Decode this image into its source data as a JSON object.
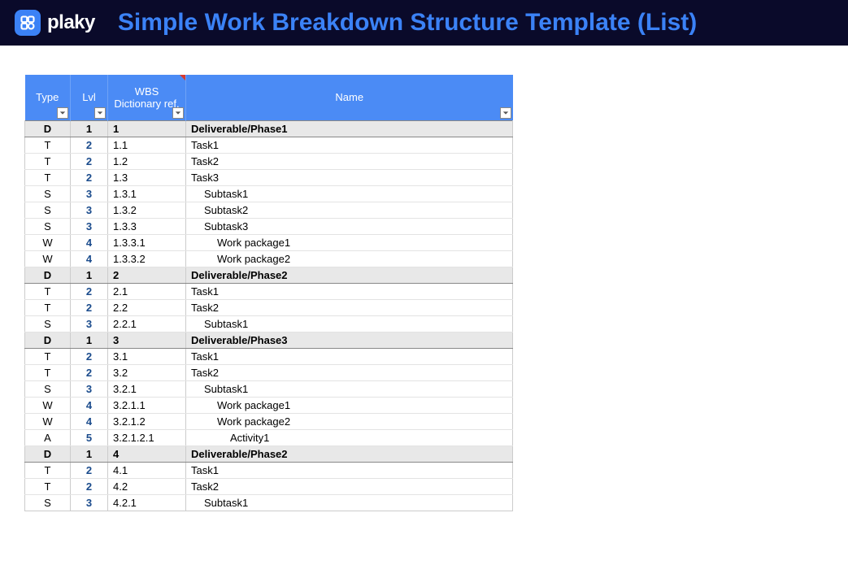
{
  "banner": {
    "brand": "plaky",
    "title": "Simple Work Breakdown Structure Template (List)"
  },
  "columns": {
    "type": "Type",
    "lvl": "Lvl",
    "wbs": "WBS Dictionary ref.",
    "name": "Name"
  },
  "rows": [
    {
      "type": "D",
      "lvl": "1",
      "wbs": "1",
      "name": "Deliverable/Phase1",
      "hl": true,
      "indent": 1
    },
    {
      "type": "T",
      "lvl": "2",
      "wbs": "1.1",
      "name": "Task1",
      "indent": 1
    },
    {
      "type": "T",
      "lvl": "2",
      "wbs": "1.2",
      "name": "Task2",
      "indent": 1
    },
    {
      "type": "T",
      "lvl": "2",
      "wbs": "1.3",
      "name": "Task3",
      "indent": 1
    },
    {
      "type": "S",
      "lvl": "3",
      "wbs": "1.3.1",
      "name": "Subtask1",
      "indent": 2
    },
    {
      "type": "S",
      "lvl": "3",
      "wbs": "1.3.2",
      "name": "Subtask2",
      "indent": 2
    },
    {
      "type": "S",
      "lvl": "3",
      "wbs": "1.3.3",
      "name": "Subtask3",
      "indent": 2
    },
    {
      "type": "W",
      "lvl": "4",
      "wbs": "1.3.3.1",
      "name": "Work package1",
      "indent": 3
    },
    {
      "type": "W",
      "lvl": "4",
      "wbs": "1.3.3.2",
      "name": "Work package2",
      "indent": 3
    },
    {
      "type": "D",
      "lvl": "1",
      "wbs": "2",
      "name": "Deliverable/Phase2",
      "hl": true,
      "indent": 1
    },
    {
      "type": "T",
      "lvl": "2",
      "wbs": "2.1",
      "name": "Task1",
      "indent": 1
    },
    {
      "type": "T",
      "lvl": "2",
      "wbs": "2.2",
      "name": "Task2",
      "indent": 1
    },
    {
      "type": "S",
      "lvl": "3",
      "wbs": "2.2.1",
      "name": "Subtask1",
      "indent": 2
    },
    {
      "type": "D",
      "lvl": "1",
      "wbs": "3",
      "name": "Deliverable/Phase3",
      "hl": true,
      "indent": 1
    },
    {
      "type": "T",
      "lvl": "2",
      "wbs": "3.1",
      "name": "Task1",
      "indent": 1
    },
    {
      "type": "T",
      "lvl": "2",
      "wbs": "3.2",
      "name": "Task2",
      "indent": 1
    },
    {
      "type": "S",
      "lvl": "3",
      "wbs": "3.2.1",
      "name": "Subtask1",
      "indent": 2
    },
    {
      "type": "W",
      "lvl": "4",
      "wbs": "3.2.1.1",
      "name": "Work package1",
      "indent": 3
    },
    {
      "type": "W",
      "lvl": "4",
      "wbs": "3.2.1.2",
      "name": "Work package2",
      "indent": 3
    },
    {
      "type": "A",
      "lvl": "5",
      "wbs": "3.2.1.2.1",
      "name": "Activity1",
      "indent": 4
    },
    {
      "type": "D",
      "lvl": "1",
      "wbs": "4",
      "name": "Deliverable/Phase2",
      "hl": true,
      "indent": 1
    },
    {
      "type": "T",
      "lvl": "2",
      "wbs": "4.1",
      "name": "Task1",
      "indent": 1
    },
    {
      "type": "T",
      "lvl": "2",
      "wbs": "4.2",
      "name": "Task2",
      "indent": 1
    },
    {
      "type": "S",
      "lvl": "3",
      "wbs": "4.2.1",
      "name": "Subtask1",
      "indent": 2
    }
  ]
}
